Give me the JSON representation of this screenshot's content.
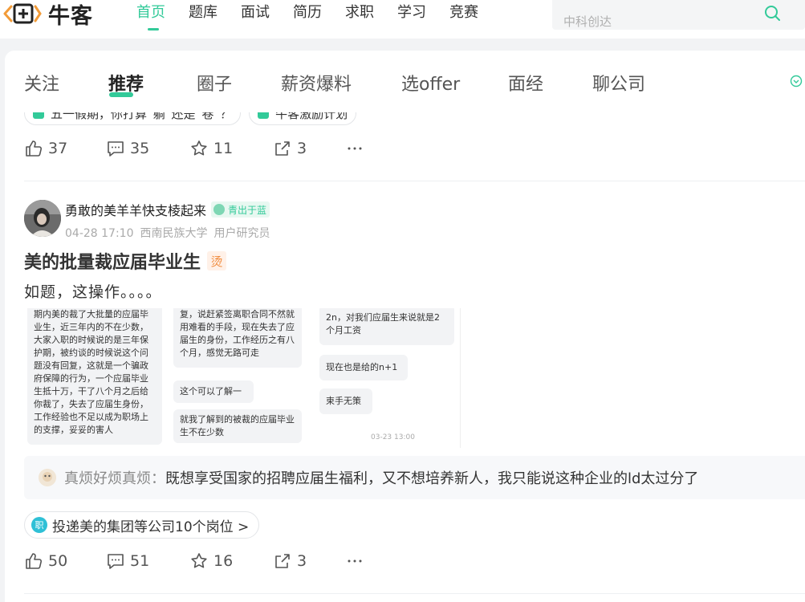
{
  "header": {
    "logo_text": "牛客",
    "nav": [
      "首页",
      "题库",
      "面试",
      "简历",
      "求职",
      "学习",
      "竞赛"
    ],
    "search_placeholder": "中科创达"
  },
  "tabs": [
    "关注",
    "推荐",
    "圈子",
    "薪资爆料",
    "选offer",
    "面经",
    "聊公司"
  ],
  "prev_post": {
    "tags": [
      "五一假期，你打算“躺”还是“卷”？",
      "牛客激励计划"
    ],
    "likes": "37",
    "comments": "35",
    "stars": "11",
    "shares": "3"
  },
  "post": {
    "author": "勇敢的美羊羊快支棱起来",
    "badge": "青出于蓝",
    "time": "04-28 17:10",
    "school": "西南民族大学",
    "role": "用户研究员",
    "title": "美的批量裁应届毕业生",
    "hot_label": "烫",
    "body": "如题，这操作。。。。",
    "screenshot1": "期内美的裁了大批量的应届毕业生，近三年内的不在少数，大家入职的时候说的是三年保护期，被约谈的时候说这个问题没有回复，这就是一个骗政府保障的行为，一个应届毕业生抵十万，干了八个月之后给你裁了，失去了应届生身份，工作经验也不足以成为职场上的支撑，妥妥的害人",
    "screenshot2_a": "复，说赶紧签离职合同不然就用难看的手段，现在失去了应届生的身份，工作经历之有八个月，感觉无路可走",
    "screenshot2_b": "这个可以了解一下",
    "screenshot2_c": "就我了解到的被裁的应届毕业生不在少数",
    "screenshot3_a": "2n，对我们应届生来说就是2个月工资",
    "screenshot3_b": "现在也是给的n+1",
    "screenshot3_c": "束手无策",
    "screenshot3_time": "03-23 13:00",
    "comment_user": "真烦好烦真烦：",
    "comment_text": "既想享受国家的招聘应届生福利，又不想培养新人，我只能说这种企业的ld太过分了",
    "job_icon": "职",
    "job_link": "投递美的集团等公司10个岗位 >",
    "likes": "50",
    "comments": "51",
    "stars": "16",
    "shares": "3"
  },
  "colors": {
    "brand": "#32ca99",
    "hot": "#f08a3c"
  }
}
